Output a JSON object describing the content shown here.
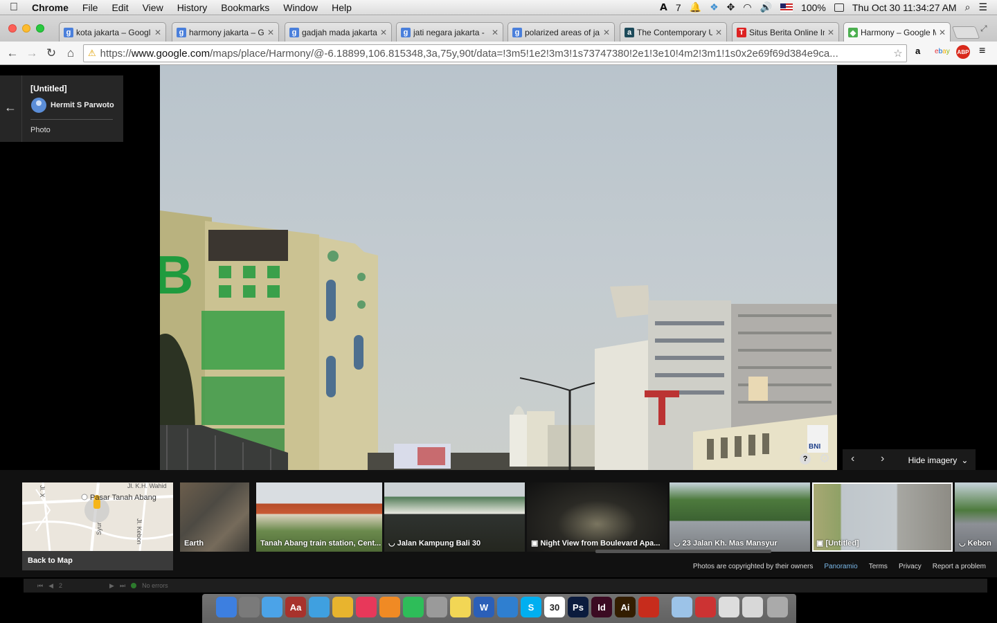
{
  "menubar": {
    "app": "Chrome",
    "items": [
      "File",
      "Edit",
      "View",
      "History",
      "Bookmarks",
      "Window",
      "Help"
    ],
    "status": {
      "notifications": "7",
      "battery": "100%",
      "datetime": "Thu Oct 30  11:34:27 AM"
    }
  },
  "tabs": [
    {
      "title": "kota jakarta – Googl",
      "favicon": "google-g",
      "color": "#4a7fdb"
    },
    {
      "title": "harmony jakarta – G",
      "favicon": "google-g",
      "color": "#4a7fdb"
    },
    {
      "title": "gadjah mada jakarta",
      "favicon": "google-g",
      "color": "#4a7fdb"
    },
    {
      "title": "jati negara jakarta -",
      "favicon": "google-g",
      "color": "#4a7fdb"
    },
    {
      "title": "polarized areas of ja",
      "favicon": "google-g",
      "color": "#4a7fdb"
    },
    {
      "title": "The Contemporary U",
      "favicon": "a",
      "color": "#1d4a5a"
    },
    {
      "title": "Situs Berita Online In",
      "favicon": "T",
      "color": "#d22"
    },
    {
      "title": "Harmony – Google M",
      "favicon": "maps",
      "color": "#4caf50"
    }
  ],
  "address": {
    "scheme": "https://",
    "host": "www.google.com",
    "path": "/maps/place/Harmony/@-6.18899,106.815348,3a,75y,90t/data=!3m5!1e2!3m3!1s73747380!2e1!3e10!4m2!3m1!1s0x2e69f69d384e9ca..."
  },
  "info_card": {
    "title": "[Untitled]",
    "author": "Hermit S Parwoto",
    "type": "Photo"
  },
  "photo_controls": {
    "hide_label": "Hide imagery"
  },
  "map_thumb": {
    "back_label": "Back to Map",
    "labels": [
      "Jl. K.H. Wahid",
      "Pasar Tanah Abang",
      "Jl. Kebon",
      "Syur",
      "Jl. X"
    ]
  },
  "filmstrip": [
    {
      "label": "Earth",
      "type": "none"
    },
    {
      "label": "Tanah Abang train station, Cent...",
      "type": "none"
    },
    {
      "label": "Jalan Kampung Bali 30",
      "type": "pano"
    },
    {
      "label": "Night View from Boulevard Apa...",
      "type": "camera"
    },
    {
      "label": "23 Jalan Kh. Mas Mansyur",
      "type": "pano"
    },
    {
      "label": "[Untitled]",
      "type": "camera",
      "selected": true
    },
    {
      "label": "Kebon",
      "type": "pano"
    }
  ],
  "footer": {
    "copyright": "Photos are copyrighted by their owners",
    "panoramio": "Panoramio",
    "terms": "Terms",
    "privacy": "Privacy",
    "report": "Report a problem"
  },
  "statusbar": {
    "page": "2",
    "errors": "No errors"
  },
  "dock": [
    "Finder",
    "System Preferences",
    "Messages",
    "Dictionary",
    "Safari",
    "Chrome",
    "iTunes",
    "iBooks",
    "Spotify",
    "Calculator",
    "Stickies",
    "Word",
    "Fetch",
    "Skype",
    "Calendar",
    "Photoshop",
    "InDesign",
    "Illustrator",
    "Acrobat",
    "Folder",
    "PDF",
    "Documents",
    "Finder Window",
    "Trash"
  ],
  "dock_calendar_day": "30",
  "photo_signs": {
    "bni": "BNI",
    "b_letter": "B"
  }
}
